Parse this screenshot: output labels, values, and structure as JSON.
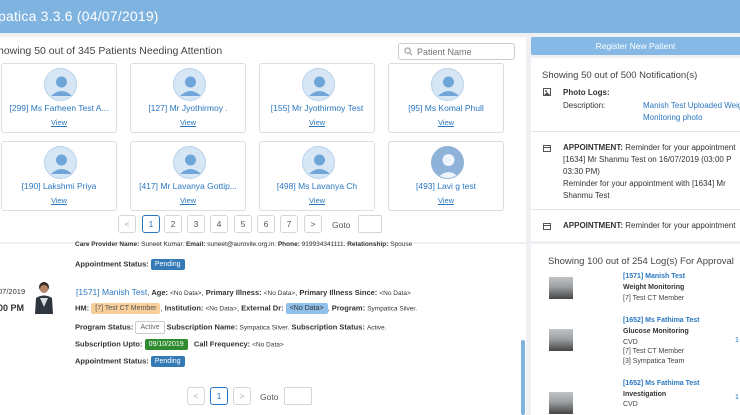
{
  "header": {
    "title": "patica 3.3.6 (04/07/2019)"
  },
  "patients": {
    "title": "howing 50 out of 345 Patients Needing Attention",
    "search_placeholder": "Patient Name",
    "view_label": "View",
    "cards": [
      {
        "name": "[299] Ms Farheen Test A..."
      },
      {
        "name": "[127] Mr Jyothirmoy ."
      },
      {
        "name": "[155] Mr Jyothirmoy Test"
      },
      {
        "name": "[95] Ms Komal Phull"
      },
      {
        "name": "[190] Lakshmi Priya"
      },
      {
        "name": "[417] Mr Lavanya Gottip..."
      },
      {
        "name": "[498] Ms Lavanya Ch"
      },
      {
        "name": "[493] Lavi  g test"
      }
    ],
    "pager": {
      "prev": "<",
      "pages": [
        "1",
        "2",
        "3",
        "4",
        "5",
        "6",
        "7"
      ],
      "next": ">",
      "goto_label": "Goto"
    }
  },
  "detail": {
    "top_row": {
      "care_provider_label": "Care Provider Name:",
      "care_provider_value": "Suneet Kumar.",
      "email_label": "Email:",
      "email_value": "suneet@aurovile.org.in.",
      "phone_label": "Phone:",
      "phone_value": "919934341111.",
      "relationship_label": "Relationship:",
      "relationship_value": "Spouse"
    },
    "appointment_status_label": "Appointment Status:",
    "appointment_status_1": "Pending",
    "date": "07/2019",
    "time": "00 PM",
    "patient_name": "[1571] Manish Test",
    "age_label": "Age:",
    "age_value": "<No Data>",
    "primary_illness_label": "Primary Illness:",
    "primary_illness_value": "<No Data>",
    "primary_illness_since_label": "Primary Illness Since:",
    "primary_illness_since_value": "<No Data>",
    "hm_label": "HM:",
    "hm_value": "[7] Test CT Member",
    "institution_label": "Institution:",
    "institution_value": "<No Data>",
    "external_dr_label": "External Dr:",
    "external_dr_value": "<No Data>",
    "program_label": "Program:",
    "program_value": "Sympatica Silver.",
    "program_status_label": "Program Status:",
    "program_status_value": "Active",
    "subscription_name_label": "Subscription Name:",
    "subscription_name_value": "Sympatica Silver.",
    "subscription_status_label": "Subscription Status:",
    "subscription_status_value": "Active.",
    "subscription_upto_label": "Subscription Upto:",
    "subscription_upto_value": "09/10/2019",
    "call_frequency_label": "Call Frequency:",
    "call_frequency_value": "<No Data>",
    "appointment_status_2": "Pending",
    "pager": {
      "prev": "<",
      "page": "1",
      "next": ">",
      "goto_label": "Goto"
    }
  },
  "right": {
    "register_button": "Register New Patient",
    "notifications": {
      "title": "Showing 50 out of 500 Notification(s)",
      "photo_logs_label": "Photo Logs:",
      "description_label": "Description:",
      "description_line1": "Manish Test Uploaded Weig",
      "description_line2": "Monitoring photo",
      "appt1_label": "APPOINTMENT:",
      "appt1_text1": "Reminder for your appointment",
      "appt1_text2": "[1634] Mr Shanmu Test on 16/07/2019 (03:00 P",
      "appt1_text3": "03:30 PM)",
      "appt1_text4": "Reminder for your appointment with [1634] Mr",
      "appt1_text5": "Shanmu Test",
      "appt2_label": "APPOINTMENT:",
      "appt2_text1": "Reminder for your appointment"
    },
    "logs": {
      "title": "Showing 100 out of 254 Log(s) For Approval",
      "items": [
        {
          "name": "[1571] Manish Test",
          "type": "Weight Monitoring",
          "line2": "[7] Test CT Member",
          "line3": ""
        },
        {
          "name": "[1652] Ms Fathima Test",
          "type": "Glucose Monitoring",
          "line2": "CVD",
          "line3": "[7] Test CT Member",
          "line4": "[3] Sympatica Team",
          "side": "1"
        },
        {
          "name": "[1652] Ms Fathima Test",
          "type": "Investigation",
          "line2": "CVD",
          "side": "1"
        }
      ]
    }
  },
  "colors": {
    "header": "#7fb3e0",
    "link": "#2a77c0",
    "pending": "#337ab7",
    "green": "#2e8b2e"
  }
}
